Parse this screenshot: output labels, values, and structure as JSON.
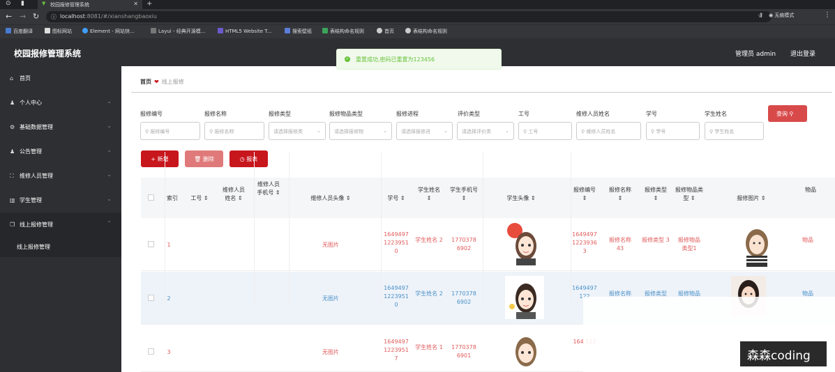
{
  "browser": {
    "tab_title": "校园报修管理系统",
    "address_host": "localhost",
    "address_path": ":8081/#/xianshangbaoxiu",
    "profile": "无痕模式",
    "bookmarks": [
      "百度翻译",
      "图标网站",
      "Element - 网站快...",
      "Layui - 经典开源模...",
      "HTML5 Website T...",
      "搜索壁纸",
      "表结构命名规则",
      "首页",
      "表结构命名规则"
    ]
  },
  "header": {
    "title": "校园报修管理系统",
    "admin": "管理员 admin",
    "logout": "退出登录"
  },
  "toast": {
    "message": "重置成功,密码已重置为123456"
  },
  "sidebar": {
    "items": [
      {
        "label": "首页",
        "icon": "home-icon"
      },
      {
        "label": "个人中心",
        "icon": "user-icon"
      },
      {
        "label": "基础数据管理",
        "icon": "gear-icon"
      },
      {
        "label": "公告管理",
        "icon": "user-icon"
      },
      {
        "label": "维修人员管理",
        "icon": "frame-icon"
      },
      {
        "label": "学生管理",
        "icon": "chart-icon"
      },
      {
        "label": "线上报修管理",
        "icon": "copy-icon"
      }
    ],
    "sub_item": "线上报修管理"
  },
  "breadcrumb": {
    "home": "首页",
    "current": "线上报修"
  },
  "filters": [
    {
      "label": "报修编号",
      "placeholder": "报修编号",
      "type": "text"
    },
    {
      "label": "报修名称",
      "placeholder": "报修名称",
      "type": "text"
    },
    {
      "label": "报修类型",
      "placeholder": "请选择报修类",
      "type": "select"
    },
    {
      "label": "报修物品类型",
      "placeholder": "请选择报修物",
      "type": "select"
    },
    {
      "label": "报修进程",
      "placeholder": "请选择报修进",
      "type": "select"
    },
    {
      "label": "评价类型",
      "placeholder": "请选择评价类",
      "type": "select"
    },
    {
      "label": "工号",
      "placeholder": "工号",
      "type": "text"
    },
    {
      "label": "维修人员姓名",
      "placeholder": "维修人员姓名",
      "type": "text"
    },
    {
      "label": "学号",
      "placeholder": "学号",
      "type": "text"
    },
    {
      "label": "学生姓名",
      "placeholder": "学生姓名",
      "type": "text"
    }
  ],
  "buttons": {
    "search": "查询",
    "add": "新增",
    "delete": "删除",
    "report": "报表"
  },
  "columns": [
    "索引",
    "工号",
    "维修人员姓名",
    "维修人员手机号",
    "维修人员头像",
    "学号",
    "学生姓名",
    "学生手机号",
    "学生头像",
    "报修编号",
    "报修名称",
    "报修类型",
    "报修物品类型",
    "报修图片",
    "物品"
  ],
  "rows": [
    {
      "index": "1",
      "no_image": "无图片",
      "student_no": "1649497 1223951 0",
      "student_name": "学生姓名 2",
      "phone": "1770378 6902",
      "repair_no": "1649497 1223936 3",
      "repair_name": "报修名称 43",
      "repair_type": "报修类型 3",
      "item_type": "报修物品 类型1",
      "item": "物品"
    },
    {
      "index": "2",
      "no_image": "无图片",
      "student_no": "1649497 1223951 0",
      "student_name": "学生姓名 2",
      "phone": "1770378 6902",
      "repair_no": "1649497 122",
      "repair_name": "报修名称",
      "repair_type": "报修类型",
      "item_type": "报修物品",
      "item": "物品"
    },
    {
      "index": "3",
      "no_image": "无图片",
      "student_no": "1649497 1223951 7",
      "student_name": "学生姓名 1",
      "phone": "1770378 6901",
      "repair_no": "164 122",
      "repair_name": "",
      "repair_type": "",
      "item_type": "",
      "item": ""
    }
  ],
  "watermark": "森森coding"
}
